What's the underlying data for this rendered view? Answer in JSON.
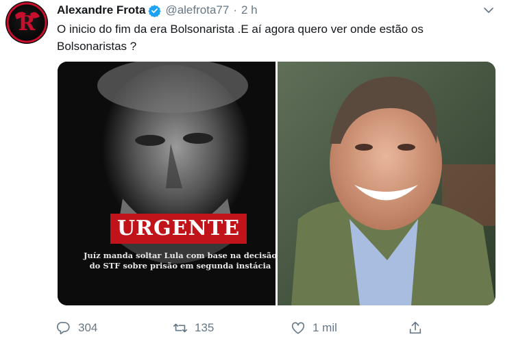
{
  "tweet": {
    "author_name": "Alexandre Frota",
    "handle": "@alefrota77",
    "separator": "·",
    "time": "2 h",
    "text": "O inicio do fim da era Bolsonarista .E aí agora quero ver onde estão os Bolsonaristas ?"
  },
  "media": {
    "left_image": {
      "badge": "URGENTE",
      "headline": "Juíz manda soltar Lula com base na decisão do STF sobre prisão em segunda instácia"
    }
  },
  "actions": {
    "replies": "304",
    "retweets": "135",
    "likes": "1 mil"
  },
  "icons": {
    "avatar": "flamengo-crest-icon",
    "verified": "verified-badge-icon",
    "caret": "chevron-down-icon",
    "reply": "reply-icon",
    "retweet": "retweet-icon",
    "like": "heart-icon",
    "share": "share-icon"
  },
  "colors": {
    "text": "#14171a",
    "secondary": "#657786",
    "verified": "#1da1f2",
    "urgent_red": "#c0141a"
  }
}
